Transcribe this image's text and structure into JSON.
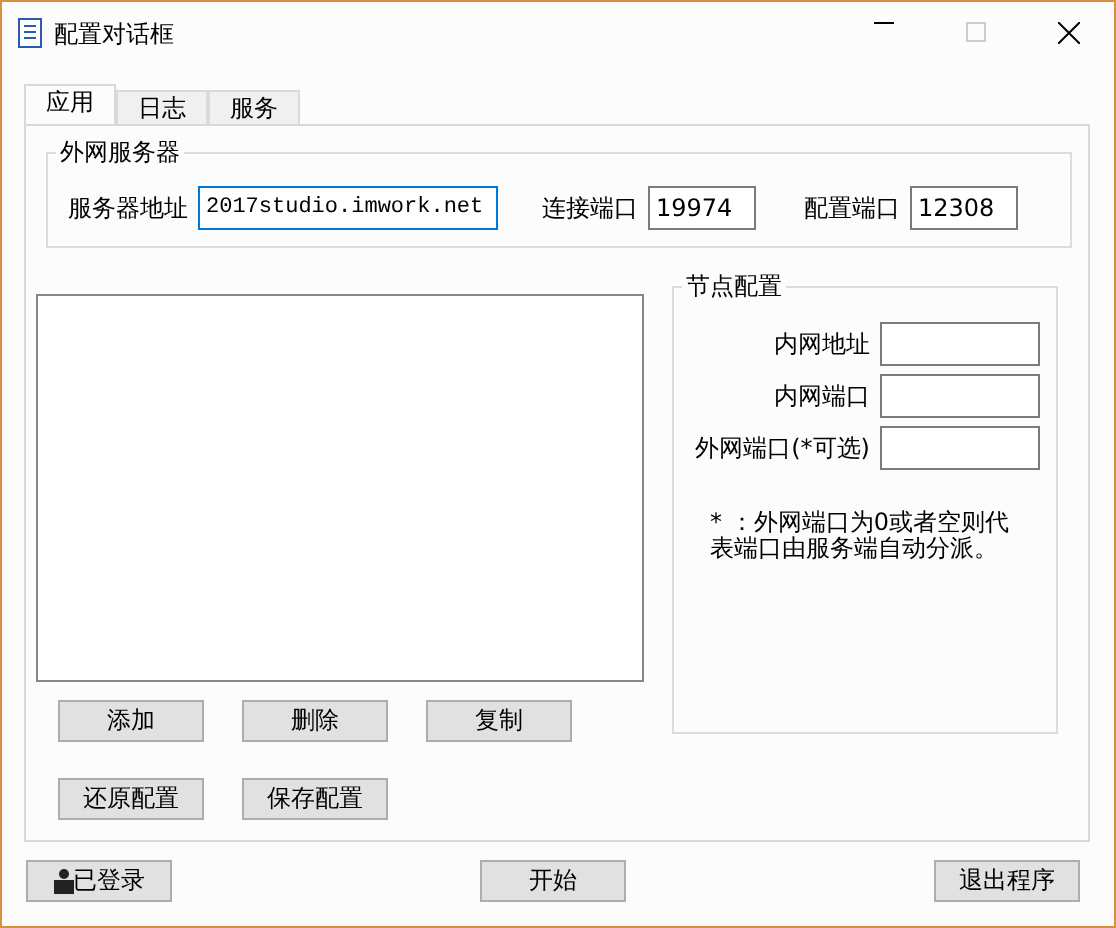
{
  "window": {
    "title": "配置对话框"
  },
  "tabs": [
    {
      "label": "应用",
      "selected": true
    },
    {
      "label": "日志",
      "selected": false
    },
    {
      "label": "服务",
      "selected": false
    }
  ],
  "external_server": {
    "title": "外网服务器",
    "fields": [
      {
        "label": "服务器地址",
        "value": "2017studio.imwork.net",
        "focused": true
      },
      {
        "label": "连接端口",
        "value": "19974",
        "focused": false
      },
      {
        "label": "配置端口",
        "value": "12308",
        "focused": false
      }
    ]
  },
  "list_buttons": [
    "添加",
    "删除",
    "复制",
    "还原配置",
    "保存配置"
  ],
  "node_config": {
    "title": "节点配置",
    "fields": [
      {
        "label": "内网地址"
      },
      {
        "label": "内网端口"
      },
      {
        "label": "外网端口(*可选)"
      }
    ],
    "note": "* ：外网端口为0或者空则代表端口由服务端自动分派。"
  },
  "footer_buttons": [
    {
      "label": "已登录",
      "kind": "status"
    },
    {
      "label": "开始",
      "kind": "plain"
    },
    {
      "label": "退出程序",
      "kind": "plain"
    }
  ]
}
